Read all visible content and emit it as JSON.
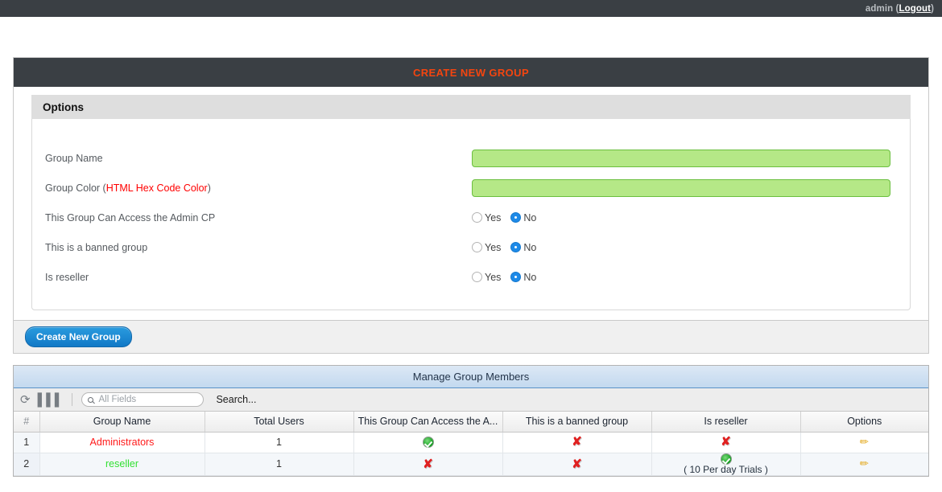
{
  "topbar": {
    "user": "admin",
    "logout_label": "Logout",
    "open_paren": " (",
    "close_paren": ")"
  },
  "create_panel": {
    "title": "CREATE NEW GROUP",
    "legend": "Options",
    "fields": {
      "group_name_label": "Group Name",
      "group_name_value": "",
      "group_color_label": "Group Color (",
      "group_color_link": "HTML Hex Code Color",
      "group_color_label_end": ")",
      "group_color_value": "",
      "admin_cp_label": "This Group Can Access the Admin CP",
      "banned_label": "This is a banned group",
      "reseller_label": "Is reseller",
      "yes_label": "Yes",
      "no_label": "No"
    },
    "submit_label": "Create New Group"
  },
  "grid": {
    "title": "Manage Group Members",
    "toolbar": {
      "refresh_icon": "refresh-icon",
      "columns_icon": "columns-icon",
      "search_placeholder": "All Fields",
      "search_value": "",
      "search_label": "Search..."
    },
    "columns": [
      "#",
      "Group Name",
      "Total Users",
      "This Group Can Access the A...",
      "This is a banned group",
      "Is reseller",
      "Options"
    ],
    "rows": [
      {
        "index": "1",
        "name": "Administrators",
        "name_color": "red",
        "total_users": "1",
        "admin_cp": "yes",
        "banned": "no",
        "reseller": "no",
        "reseller_note": "",
        "options_icon": "edit-pencil-icon"
      },
      {
        "index": "2",
        "name": "reseller",
        "name_color": "green",
        "total_users": "1",
        "admin_cp": "no",
        "banned": "no",
        "reseller": "yes",
        "reseller_note": "( 10 Per day Trials )",
        "options_icon": "edit-pencil-icon"
      }
    ]
  }
}
